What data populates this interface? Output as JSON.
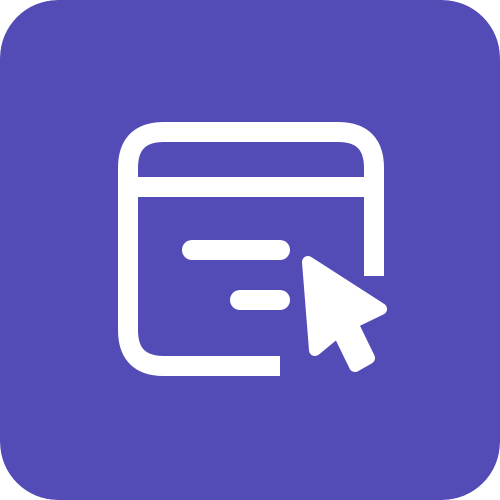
{
  "app_icon": {
    "name": "browser-window-cursor-icon",
    "background_color": "#544CB6",
    "glyph_color": "#FFFFFF",
    "parts": [
      "browser-window-icon",
      "text-lines-icon",
      "cursor-arrow-icon"
    ]
  }
}
